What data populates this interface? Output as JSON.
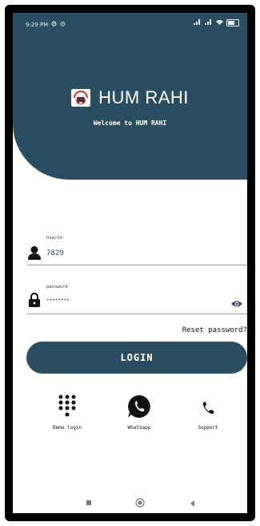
{
  "status_bar": {
    "time": "9:29 PM"
  },
  "brand": {
    "title": "HUM RAHI",
    "welcome": "Welcome to HUM RAHI"
  },
  "userid": {
    "label": "UserId",
    "value": "7829"
  },
  "password": {
    "label": "password",
    "value": "••••••••"
  },
  "reset_label": "Reset password?",
  "login_label": "LOGIN",
  "actions": [
    {
      "label": "Demo login",
      "icon": "dialpad-icon"
    },
    {
      "label": "Whatsapp",
      "icon": "whatsapp-icon"
    },
    {
      "label": "Support",
      "icon": "phone-icon"
    }
  ],
  "colors": {
    "primary": "#2a4d60",
    "accent": "#2a4d60",
    "background": "#ffffff"
  }
}
